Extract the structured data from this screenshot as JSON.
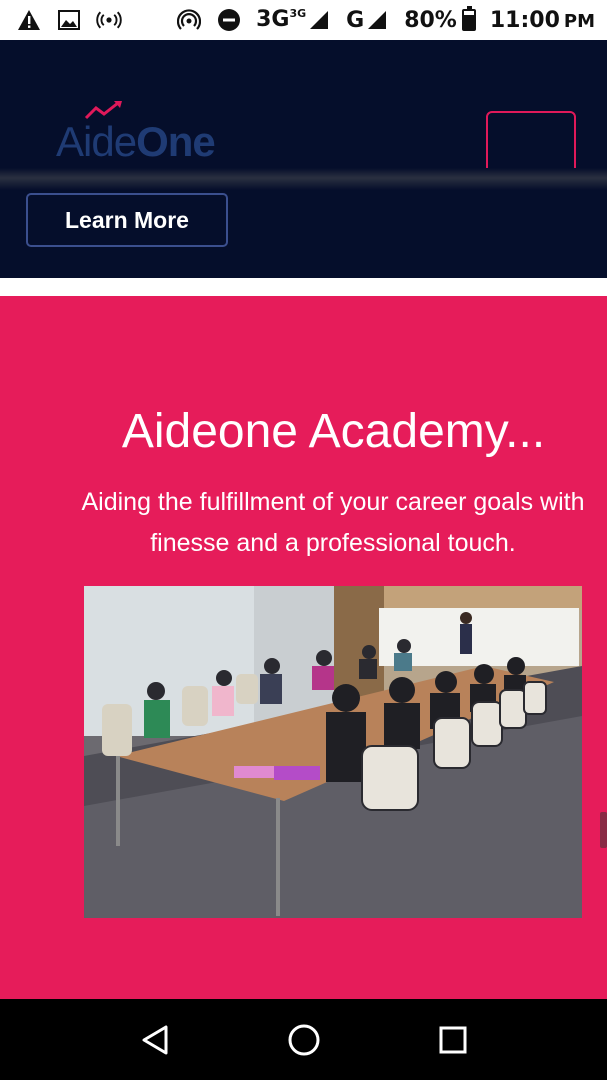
{
  "status_bar": {
    "network_type": "3G",
    "network_type_small": "3G",
    "signal_label": "G",
    "battery_percent": "80%",
    "battery_level": 0.8,
    "time": "11:00",
    "ampm": "PM",
    "icons": [
      "alert-icon",
      "image-icon",
      "broadcast-icon",
      "hotspot-icon",
      "do-not-disturb-icon",
      "signal-icon",
      "battery-icon"
    ]
  },
  "header": {
    "logo": {
      "light": "Aide",
      "bold": "One"
    },
    "brand_colors": {
      "navy": "#050e2b",
      "accent": "#e0195a",
      "logo_blue": "#1f3b74"
    },
    "learn_more_label": "Learn More"
  },
  "academy": {
    "title": "Aideone Academy...",
    "subtitle": "Aiding the fulfillment of your career goals with finesse and a professional touch.",
    "background": "#e61c5a"
  },
  "nav_bar": {
    "icons": [
      "back-icon",
      "home-icon",
      "recents-icon"
    ]
  }
}
